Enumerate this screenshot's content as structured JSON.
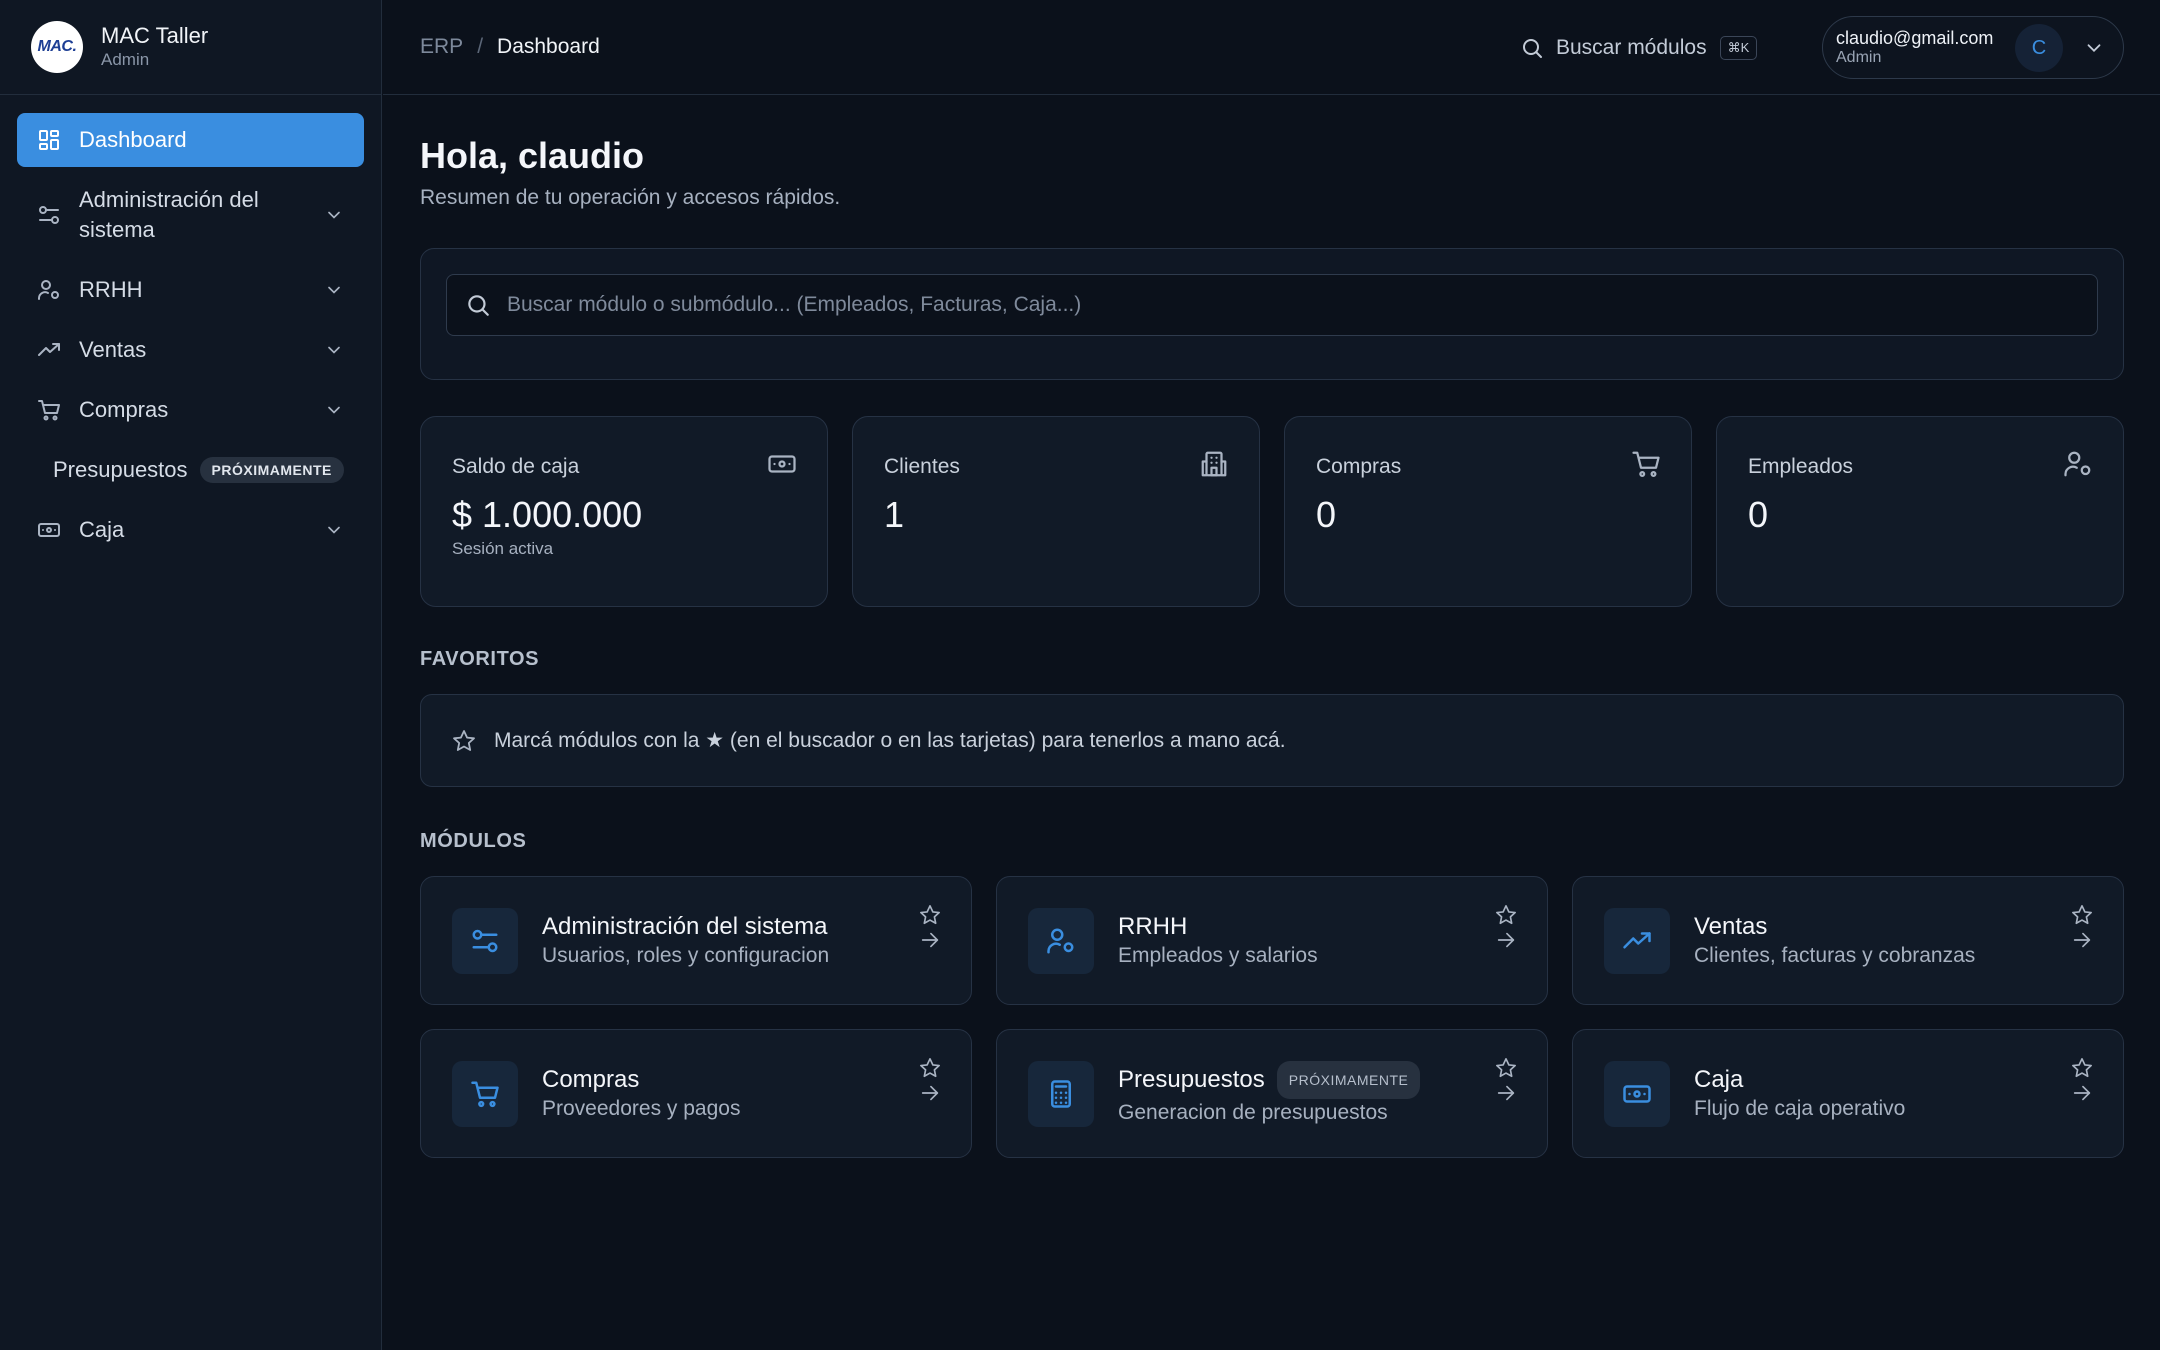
{
  "brand": {
    "logo_text": "MAC.",
    "name": "MAC Taller",
    "role": "Admin"
  },
  "sidebar": {
    "items": [
      {
        "label": "Dashboard",
        "icon": "dashboard-grid-icon",
        "active": true
      },
      {
        "label": "Administración del sistema",
        "icon": "sliders-icon"
      },
      {
        "label": "RRHH",
        "icon": "user-settings-icon"
      },
      {
        "label": "Ventas",
        "icon": "trending-up-icon"
      },
      {
        "label": "Compras",
        "icon": "cart-icon"
      },
      {
        "label": "Presupuestos",
        "badge": "PRÓXIMAMENTE"
      },
      {
        "label": "Caja",
        "icon": "banknote-icon"
      }
    ]
  },
  "topbar": {
    "breadcrumb_root": "ERP",
    "breadcrumb_separator": "/",
    "breadcrumb_current": "Dashboard",
    "search_label": "Buscar módulos",
    "search_shortcut": "⌘K",
    "user_email": "claudio@gmail.com",
    "user_role": "Admin",
    "user_initial": "C"
  },
  "main": {
    "greeting": "Hola, claudio",
    "subtitle": "Resumen de tu operación y accesos rápidos.",
    "search_placeholder": "Buscar módulo o submódulo... (Empleados, Facturas, Caja...)",
    "stats": [
      {
        "label": "Saldo de caja",
        "value": "$ 1.000.000",
        "note": "Sesión activa",
        "icon": "banknote-icon"
      },
      {
        "label": "Clientes",
        "value": "1",
        "icon": "building-icon"
      },
      {
        "label": "Compras",
        "value": "0",
        "icon": "cart-icon"
      },
      {
        "label": "Empleados",
        "value": "0",
        "icon": "user-settings-icon"
      }
    ],
    "favorites_title": "FAVORITOS",
    "favorites_empty": "Marcá módulos con la ★ (en el buscador o en las tarjetas) para tenerlos a mano acá.",
    "modules_title": "MÓDULOS",
    "modules": [
      {
        "title": "Administración del sistema",
        "desc": "Usuarios, roles y configuracion",
        "icon": "sliders-icon"
      },
      {
        "title": "RRHH",
        "desc": "Empleados y salarios",
        "icon": "user-settings-icon"
      },
      {
        "title": "Ventas",
        "desc": "Clientes, facturas y cobranzas",
        "icon": "trending-up-icon"
      },
      {
        "title": "Compras",
        "desc": "Proveedores y pagos",
        "icon": "cart-icon"
      },
      {
        "title": "Presupuestos",
        "badge": "PRÓXIMAMENTE",
        "desc": "Generacion de presupuestos",
        "icon": "calculator-icon"
      },
      {
        "title": "Caja",
        "desc": "Flujo de caja operativo",
        "icon": "banknote-icon"
      }
    ]
  },
  "colors": {
    "background": "#0b111b",
    "sidebar": "#0f1723",
    "card": "#111a27",
    "accent": "#3a8ee0",
    "border": "#263244"
  }
}
